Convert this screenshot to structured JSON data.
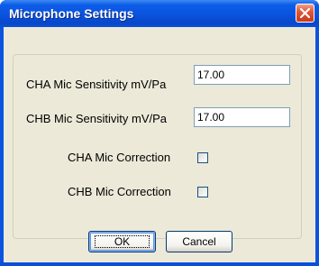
{
  "window": {
    "title": "Microphone Settings",
    "close_icon": "close-icon"
  },
  "fields": {
    "cha_label": "CHA Mic Sensitivity mV/Pa",
    "cha_value": "17.00",
    "chb_label": "CHB Mic Sensitivity mV/Pa",
    "chb_value": "17.00"
  },
  "checkboxes": {
    "cha_label": "CHA Mic Correction",
    "cha_checked": false,
    "chb_label": "CHB Mic Correction",
    "chb_checked": false
  },
  "buttons": {
    "ok": "OK",
    "cancel": "Cancel"
  },
  "colors": {
    "title_bar": "#0a53dd",
    "client_bg": "#ece9d8",
    "close_button": "#e0583a"
  }
}
